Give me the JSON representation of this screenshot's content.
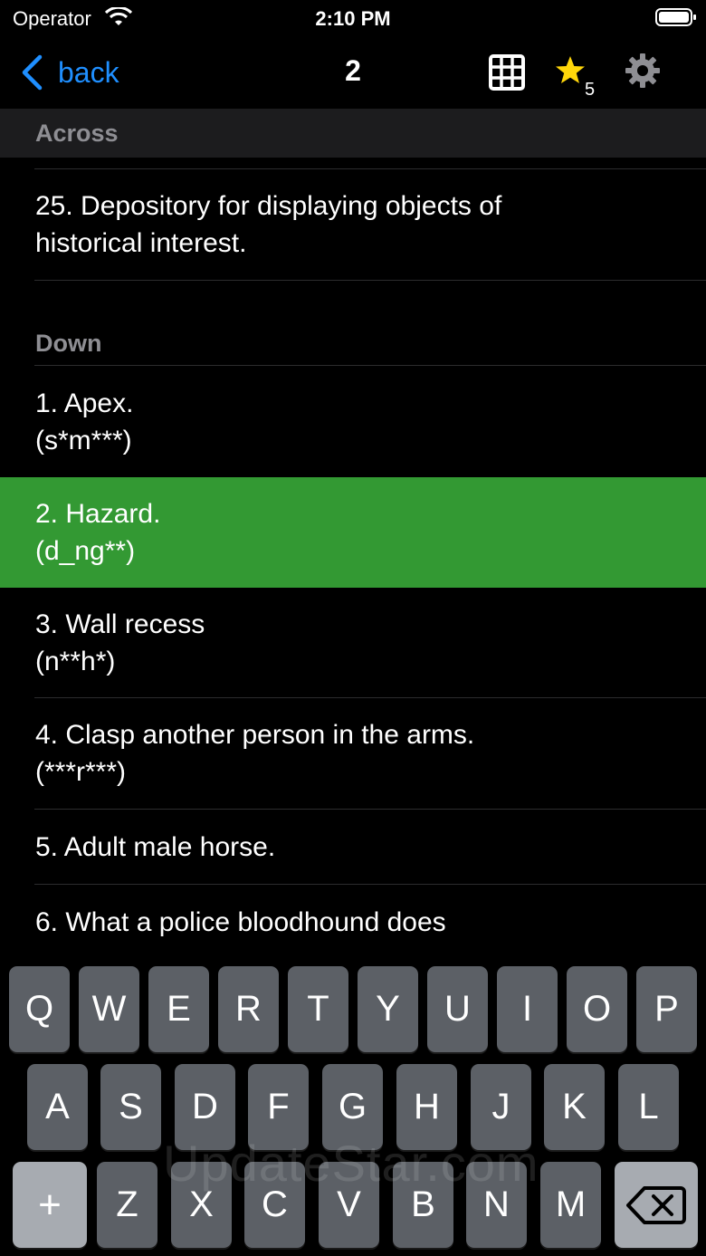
{
  "status_bar": {
    "carrier": "Operator",
    "time": "2:10 PM"
  },
  "nav": {
    "back_label": "back",
    "title": "2",
    "favorites_count": "5",
    "icons": [
      "chevron-left-icon",
      "grid-icon",
      "star-icon",
      "gear-icon"
    ]
  },
  "across": {
    "header": "Across",
    "clues": [
      {
        "line1": "25. Depository for displaying objects of",
        "line2": "historical interest."
      }
    ]
  },
  "down": {
    "header": "Down",
    "clues": [
      {
        "line1": "1. Apex.",
        "line2": "(s*m***)"
      },
      {
        "line1": "2. Hazard.",
        "line2": "(d_ng**)",
        "selected": true
      },
      {
        "line1": "3. Wall recess",
        "line2": "(n**h*)"
      },
      {
        "line1": "4. Clasp another person in the arms.",
        "line2": "(***r***)"
      },
      {
        "line1": "5. Adult male horse."
      },
      {
        "line1": "6. What a police bloodhound does"
      }
    ]
  },
  "keyboard": {
    "row1": [
      "Q",
      "W",
      "E",
      "R",
      "T",
      "Y",
      "U",
      "I",
      "O",
      "P"
    ],
    "row2": [
      "A",
      "S",
      "D",
      "F",
      "G",
      "H",
      "J",
      "K",
      "L"
    ],
    "row3": [
      "Z",
      "X",
      "C",
      "V",
      "B",
      "N",
      "M"
    ],
    "plus_label": "+"
  },
  "watermark": "UpdateStar.com",
  "colors": {
    "accent": "#1f8fff",
    "selected_row": "#339933",
    "star": "#ffd60a",
    "key": "#5c6066",
    "special_key": "#a7abb1"
  }
}
